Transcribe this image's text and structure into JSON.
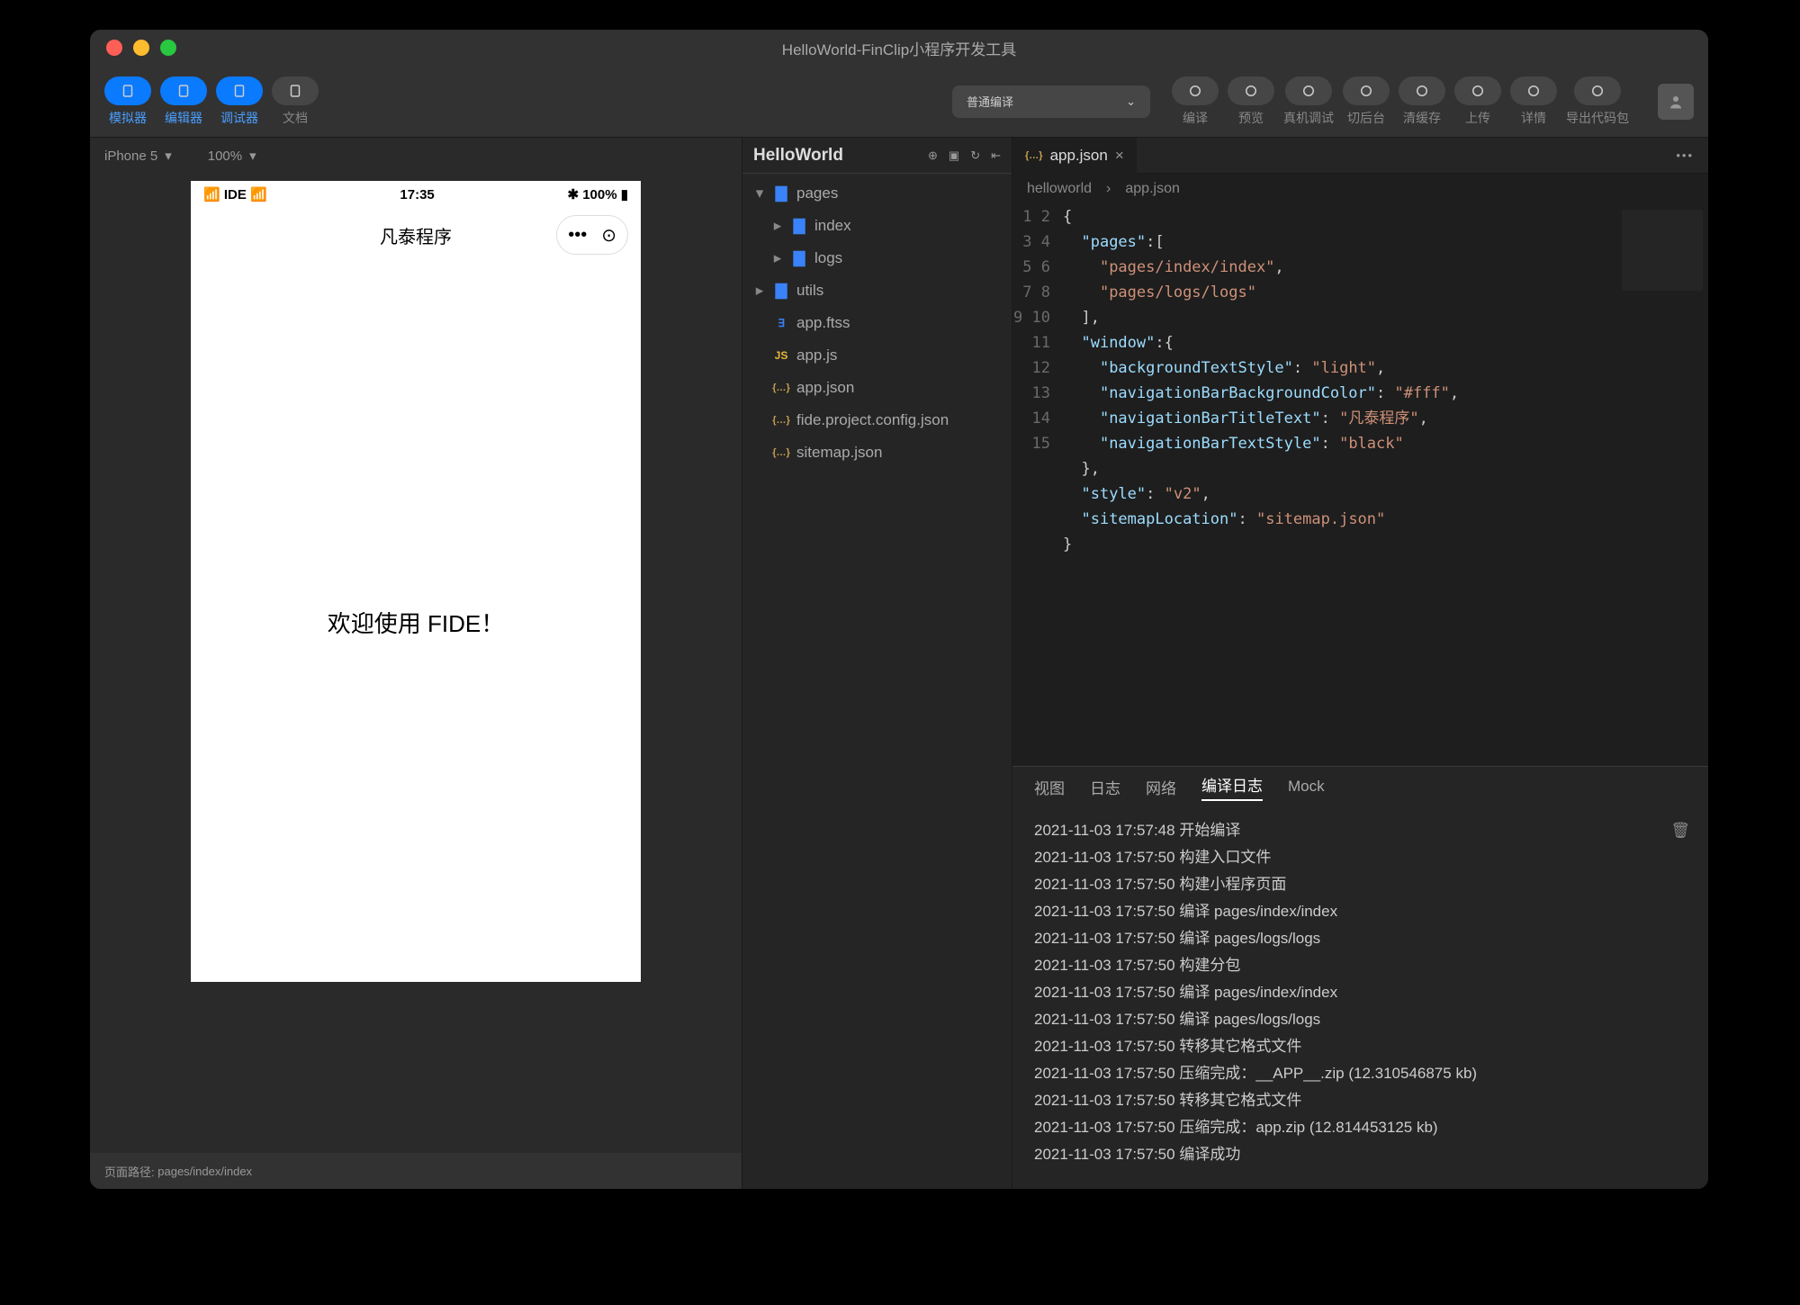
{
  "window_title": "HelloWorld-FinClip小程序开发工具",
  "toolbar": {
    "left": [
      {
        "label": "模拟器",
        "icon": "phone-icon",
        "blue": true
      },
      {
        "label": "编辑器",
        "icon": "code-icon",
        "blue": true
      },
      {
        "label": "调试器",
        "icon": "sliders-icon",
        "blue": true
      },
      {
        "label": "文档",
        "icon": "doc-icon",
        "blue": false
      }
    ],
    "compile_mode": "普通编译",
    "actions": [
      {
        "label": "编译",
        "icon": "refresh-icon"
      },
      {
        "label": "预览",
        "icon": "eye-icon"
      },
      {
        "label": "真机调试",
        "icon": "device-debug-icon"
      },
      {
        "label": "切后台",
        "icon": "background-icon"
      },
      {
        "label": "清缓存",
        "icon": "broom-icon"
      },
      {
        "label": "上传",
        "icon": "upload-icon"
      },
      {
        "label": "详情",
        "icon": "info-icon"
      },
      {
        "label": "导出代码包",
        "icon": "export-icon"
      }
    ]
  },
  "simulator": {
    "device": "iPhone 5",
    "zoom": "100%",
    "status_left": "IDE",
    "status_time": "17:35",
    "status_batt": "100%",
    "nav_title": "凡泰程序",
    "body_text": "欢迎使用 FIDE！",
    "footer_label": "页面路径:",
    "footer_path": "pages/index/index"
  },
  "explorer": {
    "project": "HelloWorld",
    "items": [
      {
        "name": "pages",
        "type": "folder",
        "depth": 0,
        "open": true
      },
      {
        "name": "index",
        "type": "folder",
        "depth": 1,
        "open": false
      },
      {
        "name": "logs",
        "type": "folder",
        "depth": 1,
        "open": false
      },
      {
        "name": "utils",
        "type": "folder",
        "depth": 0,
        "open": false
      },
      {
        "name": "app.ftss",
        "type": "ftss",
        "depth": 0
      },
      {
        "name": "app.js",
        "type": "js",
        "depth": 0
      },
      {
        "name": "app.json",
        "type": "json",
        "depth": 0
      },
      {
        "name": "fide.project.config.json",
        "type": "json",
        "depth": 0
      },
      {
        "name": "sitemap.json",
        "type": "json",
        "depth": 0
      }
    ]
  },
  "editor": {
    "tab_file": "app.json",
    "breadcrumb": [
      "helloworld",
      "app.json"
    ],
    "code": {
      "1": "{",
      "2": "  \"pages\":[",
      "3": "    \"pages/index/index\",",
      "4": "    \"pages/logs/logs\"",
      "5": "  ],",
      "6": "  \"window\":{",
      "7": "    \"backgroundTextStyle\":\"light\",",
      "8": "    \"navigationBarBackgroundColor\": \"#fff\",",
      "9": "    \"navigationBarTitleText\": \"凡泰程序\",",
      "10": "    \"navigationBarTextStyle\":\"black\"",
      "11": "  },",
      "12": "  \"style\": \"v2\",",
      "13": "  \"sitemapLocation\": \"sitemap.json\"",
      "14": "}",
      "15": ""
    }
  },
  "panel": {
    "tabs": [
      "视图",
      "日志",
      "网络",
      "编译日志",
      "Mock"
    ],
    "active": "编译日志",
    "logs": [
      "2021-11-03 17:57:48 开始编译",
      "2021-11-03 17:57:50 构建入口文件",
      "2021-11-03 17:57:50 构建小程序页面",
      "2021-11-03 17:57:50 编译 pages/index/index",
      "2021-11-03 17:57:50 编译 pages/logs/logs",
      "2021-11-03 17:57:50 构建分包",
      "2021-11-03 17:57:50 编译 pages/index/index",
      "2021-11-03 17:57:50 编译 pages/logs/logs",
      "2021-11-03 17:57:50 转移其它格式文件",
      "2021-11-03 17:57:50 压缩完成：__APP__.zip (12.310546875 kb)",
      "2021-11-03 17:57:50 转移其它格式文件",
      "2021-11-03 17:57:50 压缩完成：app.zip (12.814453125 kb)",
      "2021-11-03 17:57:50 编译成功"
    ]
  }
}
